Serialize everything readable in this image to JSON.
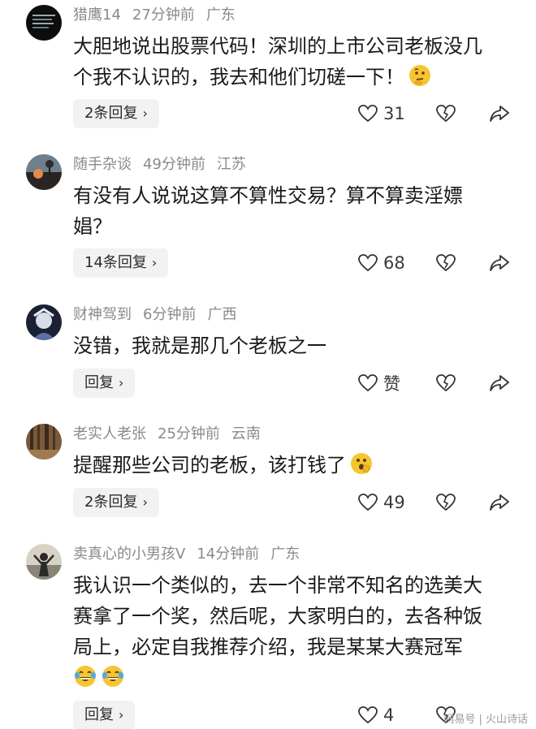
{
  "comments": [
    {
      "username": "猎鹰14",
      "time": "27分钟前",
      "location": "广东",
      "lines": [
        "大胆地说出股票代码！深圳的上市公司老板没几",
        "个我不认识的，我去和他们切磋一下！"
      ],
      "emojis": [
        "thinking-face"
      ],
      "reply_label": "2条回复",
      "likes": "31"
    },
    {
      "username": "随手杂谈",
      "time": "49分钟前",
      "location": "江苏",
      "lines": [
        "有没有人说说这算不算性交易？算不算卖淫嫖",
        "娼？"
      ],
      "emojis": [],
      "reply_label": "14条回复",
      "likes": "68"
    },
    {
      "username": "财神驾到",
      "time": "6分钟前",
      "location": "广西",
      "lines": [
        "没错，我就是那几个老板之一"
      ],
      "emojis": [],
      "reply_label": "回复",
      "likes": "赞"
    },
    {
      "username": "老实人老张",
      "time": "25分钟前",
      "location": "云南",
      "lines": [
        "提醒那些公司的老板，该打钱了"
      ],
      "emojis": [
        "hand-over-mouth-face"
      ],
      "reply_label": "2条回复",
      "likes": "49"
    },
    {
      "username": "卖真心的小男孩V",
      "time": "14分钟前",
      "location": "广东",
      "lines": [
        "我认识一个类似的，去一个非常不知名的选美大",
        "赛拿了一个奖，然后呢，大家明白的，去各种饭",
        "局上，必定自我推荐介绍，我是某某大赛冠军"
      ],
      "emojis": [
        "tears-of-joy-face",
        "tears-of-joy-face"
      ],
      "reply_label": "回复",
      "likes": "4"
    }
  ],
  "watermark": "网易号 | 火山诗话",
  "icons": {
    "like": "heart-outline-icon",
    "dislike": "broken-heart-icon",
    "share": "share-arrow-icon",
    "chevron": "chevron-right-icon"
  }
}
